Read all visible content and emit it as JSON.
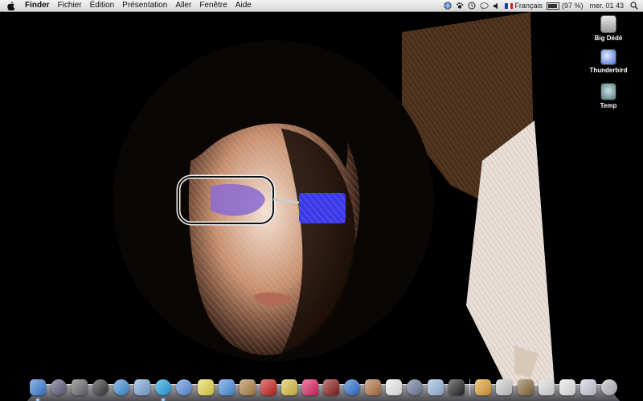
{
  "menubar": {
    "apple_icon": "apple-icon",
    "app_name": "Finder",
    "menus": [
      "Fichier",
      "Édition",
      "Présentation",
      "Aller",
      "Fenêtre",
      "Aide"
    ],
    "status": {
      "input_language": "Français",
      "battery_text": "(97 %)",
      "battery_level": 0.97,
      "clock": "mer. 01 43"
    }
  },
  "desktop_icons": [
    {
      "label": "Big Dédé",
      "icon": "hard-drive-icon"
    },
    {
      "label": "Thunderbird",
      "icon": "thunderbird-icon"
    },
    {
      "label": "Temp",
      "icon": "folder-image-icon"
    }
  ],
  "dock": {
    "items": [
      {
        "name": "finder",
        "color": "#3a7bd5",
        "running": true
      },
      {
        "name": "system-x",
        "color": "#5a5a7a",
        "running": false
      },
      {
        "name": "exposé",
        "color": "#666",
        "running": false
      },
      {
        "name": "dashboard",
        "color": "#333",
        "running": false
      },
      {
        "name": "safari",
        "color": "#3d8fd8",
        "running": false
      },
      {
        "name": "mail",
        "color": "#7aa7d8",
        "running": false
      },
      {
        "name": "skype",
        "color": "#1fa0e3",
        "running": true
      },
      {
        "name": "ichat",
        "color": "#5b8fe0",
        "running": false
      },
      {
        "name": "stickies",
        "color": "#e8d84a",
        "running": false
      },
      {
        "name": "itunes",
        "color": "#4a8fe0",
        "running": false
      },
      {
        "name": "garageband",
        "color": "#b08040",
        "running": false
      },
      {
        "name": "front-row",
        "color": "#c8201a",
        "running": false
      },
      {
        "name": "imovie",
        "color": "#d8c040",
        "running": false
      },
      {
        "name": "iweb",
        "color": "#e02060",
        "running": false
      },
      {
        "name": "dvd",
        "color": "#8a1a1a",
        "running": false
      },
      {
        "name": "photo-booth",
        "color": "#2a6fd0",
        "running": false
      },
      {
        "name": "iphoto",
        "color": "#b07040",
        "running": false
      },
      {
        "name": "font-book",
        "color": "#eee",
        "running": false
      },
      {
        "name": "system-preferences",
        "color": "#6a7a9a",
        "running": false
      },
      {
        "name": "preview",
        "color": "#9ab8e0",
        "running": false
      },
      {
        "name": "terminal",
        "color": "#222",
        "running": false
      },
      {
        "name": "sep",
        "color": "",
        "running": false
      },
      {
        "name": "downloads-stack",
        "color": "#e0a030",
        "running": false
      },
      {
        "name": "window-1",
        "color": "#ccc",
        "running": false
      },
      {
        "name": "window-2",
        "color": "#8a6a40",
        "running": false
      },
      {
        "name": "window-3",
        "color": "#ddd",
        "running": false
      },
      {
        "name": "window-4",
        "color": "#e8e8e8",
        "running": false
      },
      {
        "name": "window-5",
        "color": "#ccd",
        "running": false
      },
      {
        "name": "trash",
        "color": "#b8b8c0",
        "running": false
      }
    ]
  },
  "colors": {
    "menubar_bg": "#e6e6e6",
    "glasses_lens": "#4a4aff",
    "skin": "#c88a6a",
    "hair_brown": "#7a5a3a"
  }
}
